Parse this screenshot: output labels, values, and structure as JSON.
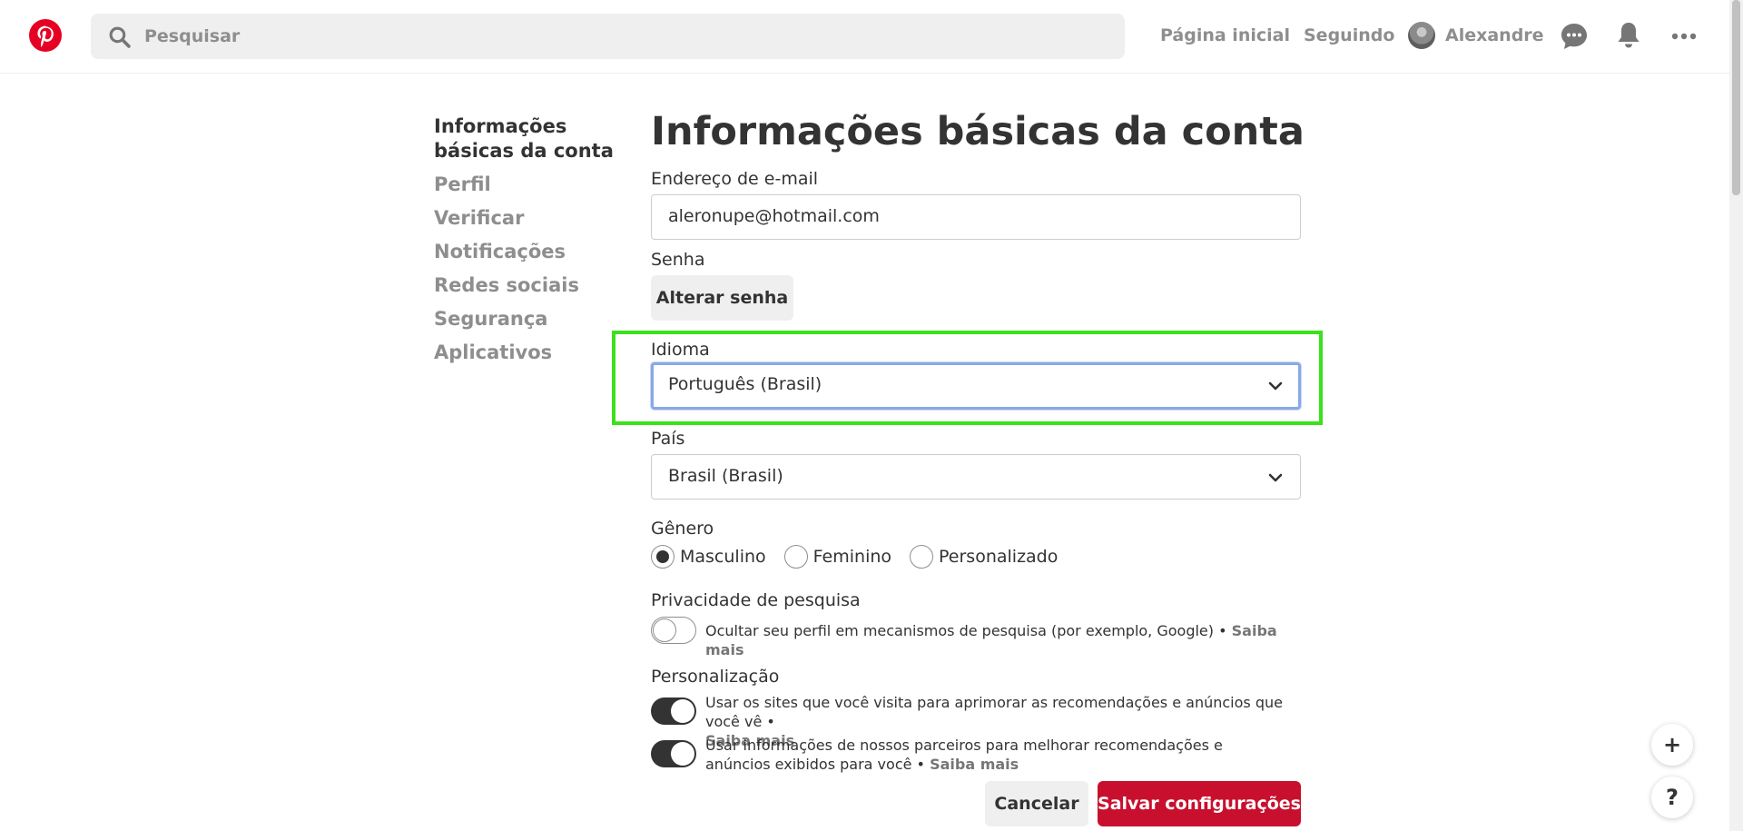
{
  "header": {
    "search_placeholder": "Pesquisar",
    "nav": {
      "home": "Página inicial",
      "following": "Seguindo",
      "user": "Alexandre"
    },
    "brand_color": "#e60023"
  },
  "sidebar": {
    "items": [
      {
        "label": "Informações básicas da conta",
        "active": true
      },
      {
        "label": "Perfil"
      },
      {
        "label": "Verificar"
      },
      {
        "label": "Notificações"
      },
      {
        "label": "Redes sociais"
      },
      {
        "label": "Segurança"
      },
      {
        "label": "Aplicativos"
      }
    ]
  },
  "main": {
    "title": "Informações básicas da conta",
    "email": {
      "label": "Endereço de e-mail",
      "value": "aleronupe@hotmail.com"
    },
    "password": {
      "label": "Senha",
      "button": "Alterar senha"
    },
    "language": {
      "label": "Idioma",
      "value": "Português (Brasil)"
    },
    "country": {
      "label": "País",
      "value": "Brasil (Brasil)"
    },
    "gender": {
      "label": "Gênero",
      "options": [
        {
          "label": "Masculino",
          "checked": true
        },
        {
          "label": "Feminino",
          "checked": false
        },
        {
          "label": "Personalizado",
          "checked": false
        }
      ]
    },
    "search_privacy": {
      "label": "Privacidade de pesquisa",
      "text": "Ocultar seu perfil em mecanismos de pesquisa (por exemplo, Google) •",
      "link": "Saiba mais",
      "enabled": false
    },
    "personalization": {
      "label": "Personalização",
      "items": [
        {
          "text": "Usar os sites que você visita para aprimorar as recomendações e anúncios que você vê •",
          "link": "Saiba mais",
          "enabled": true
        },
        {
          "text": "Usar informações de nossos parceiros para melhorar recomendações e anúncios exibidos para você •",
          "link": "Saiba mais",
          "enabled": true
        }
      ]
    },
    "cancel_label": "Cancelar",
    "save_label": "Salvar configurações",
    "save_color": "#c8102e"
  },
  "floating": {
    "plus": "+",
    "help": "?"
  },
  "highlight_color": "#3be11a"
}
